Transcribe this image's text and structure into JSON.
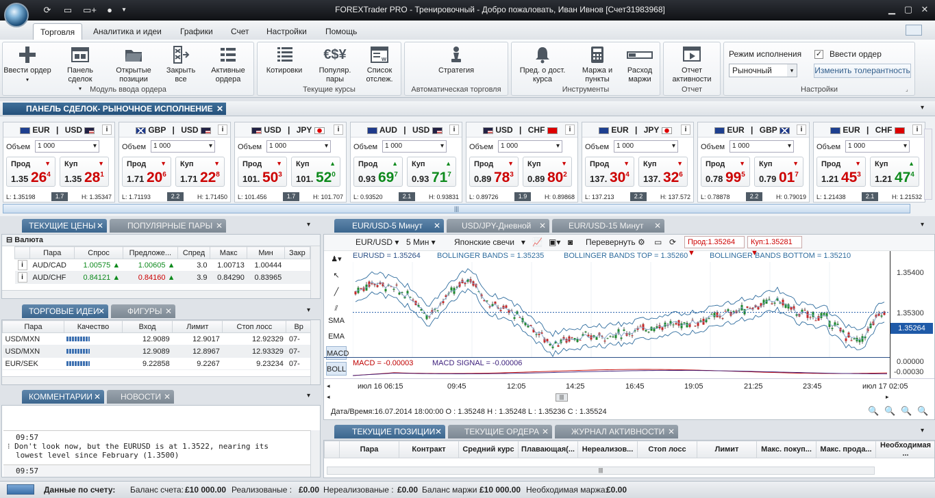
{
  "app": {
    "title": "FOREXTrader PRO - Тренировочный - Добро пожаловать,  Иван Ивнов [Счет31983968]"
  },
  "menu": [
    "Торговля",
    "Аналитика и идеи",
    "Графики",
    "Счет",
    "Настройки",
    "Помощь"
  ],
  "ribbon": {
    "groups": [
      "Модуль ввода ордера",
      "Текущие курсы",
      "Автоматическая торговля",
      "Инструменты",
      "Отчет",
      "Настройки"
    ],
    "buttons": {
      "new_order": "Ввести ордер",
      "deal_panel": "Панель сделок",
      "open_pos_1": "Открытые",
      "open_pos_2": "позиции",
      "close_all_1": "Закрыть",
      "close_all_2": "все",
      "active_1": "Активные",
      "active_2": "ордера",
      "quotes": "Котировки",
      "popular_1": "Популяр.",
      "popular_2": "пары",
      "watch_1": "Список",
      "watch_2": "отслеж.",
      "strategy": "Стратегия",
      "margin_notice_1": "Пред. о дост.",
      "margin_notice_2": "курса",
      "margin_pts_1": "Маржа и",
      "margin_pts_2": "пункты",
      "margin_exp_1": "Расход",
      "margin_exp_2": "маржи",
      "activity_1": "Отчет",
      "activity_2": "активности"
    },
    "exec_mode_label": "Режим исполнения",
    "exec_mode_value": "Рыночный",
    "enter_order_check": "Ввести ордер",
    "change_tolerance": "Изменить толерантность"
  },
  "deal_panel": {
    "title": "ПАНЕЛЬ СДЕЛОК- РЫНОЧНОЕ ИСПОЛНЕНИЕ",
    "volume_label": "Объем",
    "sell_label": "Прод",
    "buy_label": "Куп",
    "cards": [
      {
        "base": "EUR",
        "quote": "USD",
        "volume": "1 000",
        "sell_big": "1.35",
        "sell_pips": "26",
        "sell_frac": "4",
        "buy_big": "1.35",
        "buy_pips": "28",
        "buy_frac": "1",
        "low": "L: 1.35198",
        "spread": "1.7",
        "high": "H: 1.35347",
        "sell_dir": "down",
        "buy_dir": "down"
      },
      {
        "base": "GBP",
        "quote": "USD",
        "volume": "1 000",
        "sell_big": "1.71",
        "sell_pips": "20",
        "sell_frac": "6",
        "buy_big": "1.71",
        "buy_pips": "22",
        "buy_frac": "8",
        "low": "L: 1.71193",
        "spread": "2.2",
        "high": "H: 1.71450",
        "sell_dir": "down",
        "buy_dir": "down"
      },
      {
        "base": "USD",
        "quote": "JPY",
        "volume": "1 000",
        "sell_big": "101.",
        "sell_pips": "50",
        "sell_frac": "3",
        "buy_big": "101.",
        "buy_pips": "52",
        "buy_frac": "0",
        "low": "L: 101.456",
        "spread": "1.7",
        "high": "H: 101.707",
        "sell_dir": "down",
        "buy_dir": "up"
      },
      {
        "base": "AUD",
        "quote": "USD",
        "volume": "1 000",
        "sell_big": "0.93",
        "sell_pips": "69",
        "sell_frac": "7",
        "buy_big": "0.93",
        "buy_pips": "71",
        "buy_frac": "7",
        "low": "L: 0.93520",
        "spread": "2.1",
        "high": "H: 0.93831",
        "sell_dir": "up",
        "buy_dir": "up"
      },
      {
        "base": "USD",
        "quote": "CHF",
        "volume": "1 000",
        "sell_big": "0.89",
        "sell_pips": "78",
        "sell_frac": "3",
        "buy_big": "0.89",
        "buy_pips": "80",
        "buy_frac": "2",
        "low": "L: 0.89726",
        "spread": "1.9",
        "high": "H: 0.89868",
        "sell_dir": "down",
        "buy_dir": "down"
      },
      {
        "base": "EUR",
        "quote": "JPY",
        "volume": "1 000",
        "sell_big": "137.",
        "sell_pips": "30",
        "sell_frac": "4",
        "buy_big": "137.",
        "buy_pips": "32",
        "buy_frac": "6",
        "low": "L: 137.213",
        "spread": "2.2",
        "high": "H: 137.572",
        "sell_dir": "down",
        "buy_dir": "down"
      },
      {
        "base": "EUR",
        "quote": "GBP",
        "volume": "1 000",
        "sell_big": "0.78",
        "sell_pips": "99",
        "sell_frac": "5",
        "buy_big": "0.79",
        "buy_pips": "01",
        "buy_frac": "7",
        "low": "L: 0.78878",
        "spread": "2.2",
        "high": "H: 0.79019",
        "sell_dir": "down",
        "buy_dir": "down"
      },
      {
        "base": "EUR",
        "quote": "CHF",
        "volume": "1 000",
        "sell_big": "1.21",
        "sell_pips": "45",
        "sell_frac": "3",
        "buy_big": "1.21",
        "buy_pips": "47",
        "buy_frac": "4",
        "low": "L: 1.21438",
        "spread": "2.1",
        "high": "H: 1.21532",
        "sell_dir": "down",
        "buy_dir": "up"
      }
    ]
  },
  "rates": {
    "tabs": [
      "ТЕКУЩИЕ ЦЕНЫ",
      "ПОПУЛЯРНЫЕ ПАРЫ"
    ],
    "group": "Валюта",
    "cols": [
      "Пара",
      "Спрос",
      "Предложе...",
      "Спред",
      "Макс",
      "Мин",
      "Закр"
    ],
    "rows": [
      {
        "pair": "AUD/CAD",
        "bid": "1.00575",
        "ask": "1.00605",
        "spread": "3.0",
        "max": "1.00713",
        "min": "1.00444",
        "close": "",
        "bid_dir": "up",
        "ask_dir": "up"
      },
      {
        "pair": "AUD/CHF",
        "bid": "0.84121",
        "ask": "0.84160",
        "spread": "3.9",
        "max": "0.84290",
        "min": "0.83965",
        "close": "",
        "bid_dir": "up",
        "ask_dir": "up"
      }
    ]
  },
  "ideas": {
    "tabs": [
      "ТОРГОВЫЕ ИДЕИ",
      "ФИГУРЫ"
    ],
    "cols": [
      "Пара",
      "Качество",
      "Вход",
      "Лимит",
      "Стоп лосс",
      "Вр"
    ],
    "rows": [
      {
        "pair": "USD/MXN",
        "entry": "12.9089",
        "limit": "12.9017",
        "stop": "12.92329",
        "time": "07-"
      },
      {
        "pair": "USD/MXN",
        "entry": "12.9089",
        "limit": "12.8967",
        "stop": "12.93329",
        "time": "07-"
      },
      {
        "pair": "EUR/SEK",
        "entry": "9.22858",
        "limit": "9.2267",
        "stop": "9.23234",
        "time": "07-"
      }
    ]
  },
  "comments": {
    "tabs": [
      "КОММЕНТАРИИ",
      "НОВОСТИ"
    ],
    "items": [
      {
        "time": "09:57",
        "line1": "Don't look now, but the EURUSD is at 1.3522, nearing its",
        "line2": "lowest level since February (1.3500)"
      },
      {
        "time": "09:57",
        "line1": "",
        "line2": ""
      }
    ]
  },
  "chart": {
    "tabs": [
      "EUR/USD-5 Минут",
      "USD/JPY-Дневной",
      "EUR/USD-15 Минут"
    ],
    "symbol": "EUR/USD",
    "interval": "5 Мин",
    "style": "Японские свечи",
    "flip": "Перевернуть",
    "sell": "Прод:1.35264",
    "buy": "Куп:1.35281",
    "legend": {
      "price": "EURUSD = 1.35264",
      "bb": "BOLLINGER BANDS = 1.35235",
      "bbtop": "BOLLINGER BANDS TOP = 1.35260",
      "bbbot": "BOLLINGER BANDS BOTTOM = 1.35210",
      "macd": "MACD = -0.00003",
      "macdsig": "MACD SIGNAL = -0.00006"
    },
    "tools": [
      "SMA",
      "EMA",
      "MACD",
      "BOLL"
    ],
    "time_labels": [
      "июл 16 06:15",
      "09:45",
      "12:05",
      "14:25",
      "16:45",
      "19:05",
      "21:25",
      "23:45",
      "июл 17 02:05"
    ],
    "info": "Дата/Время:16.07.2014 18:00:00 O : 1.35248 H : 1.35248 L : 1.35236 C : 1.35524",
    "cursor_price": "1.35264"
  },
  "chart_data": {
    "type": "candlestick",
    "y_ticks": [
      "1.35400",
      "1.35300"
    ],
    "macd_ticks": [
      "0.00000",
      "-0.00030"
    ],
    "current": 1.35264,
    "ylim": [
      1.3506,
      1.3549
    ]
  },
  "positions": {
    "tabs": [
      "ТЕКУЩИЕ ПОЗИЦИИ",
      "ТЕКУЩИЕ ОРДЕРА",
      "ЖУРНАЛ АКТИВНОСТИ"
    ],
    "cols": [
      "Пара",
      "Контракт",
      "Средний курс",
      "Плавающая(...",
      "Нереализов...",
      "Стоп лосс",
      "Лимит",
      "Макс. покуп...",
      "Макс. прода...",
      "Необходимая ..."
    ]
  },
  "status": {
    "label": "Данные по счету:",
    "balance_l": "Баланс счета:",
    "balance": "£10 000.00",
    "realized_l": "Реализованые :",
    "realized": "£0.00",
    "unreal_l": "Нереализованые :",
    "unreal": "£0.00",
    "margin_bal_l": "Баланс маржи :",
    "margin_bal": "£10 000.00",
    "req_margin_l": "Необходимая маржа:",
    "req_margin": "£0.00"
  }
}
